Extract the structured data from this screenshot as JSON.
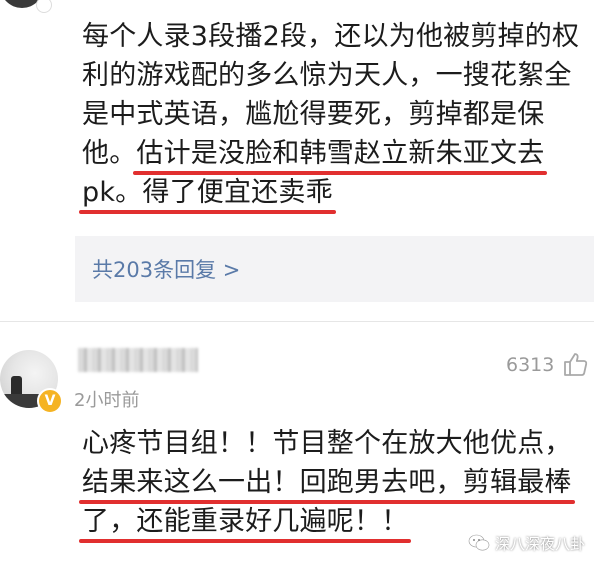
{
  "comment_1": {
    "lines": [
      {
        "plain": "每个人录3段播2段，还以为他被剪掉的权",
        "marked": ""
      },
      {
        "plain": "利的游戏配的多么惊为天人，一搜花絮全",
        "marked": ""
      },
      {
        "plain": "是中式英语，尴尬得要死，剪掉都是保",
        "marked": ""
      },
      {
        "plain": "他。",
        "marked": "估计是没脸和韩雪赵立新朱亚文去"
      },
      {
        "plain": "",
        "marked": "pk。得了便宜还卖乖"
      }
    ]
  },
  "replies": {
    "label": "共203条回复 >"
  },
  "comment_2": {
    "time": "2小时前",
    "likes": "6313",
    "lines": [
      {
        "plain": "心疼节目组！！节目整个在放大他优点，",
        "marked": ""
      },
      {
        "plain": "",
        "marked": "结果来这么一出！回跑男去吧，剪辑最棒"
      },
      {
        "plain": "",
        "marked": "了，还能重录好几遍呢！！"
      }
    ]
  },
  "watermark": {
    "text": "深八深夜八卦"
  },
  "colors": {
    "underline": "#e12f2f",
    "link": "#5a7aa8",
    "meta": "#9a9a9a",
    "reply_bg": "#f3f3f5",
    "badge": "#f5b323"
  },
  "icons": {
    "like": "thumbs-up-icon",
    "verified": "verified-badge-icon",
    "watermark": "wechat-icon"
  }
}
